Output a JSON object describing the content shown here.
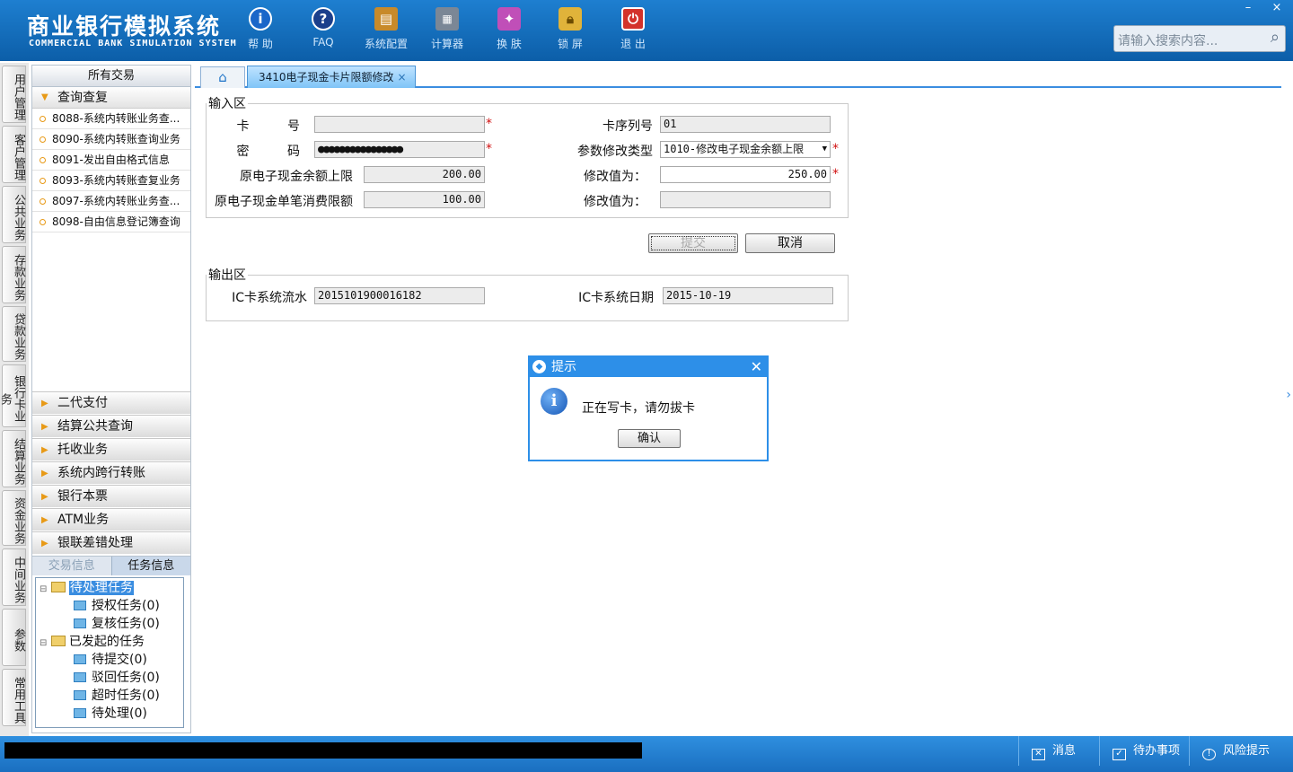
{
  "app": {
    "title_cn": "商业银行模拟系统",
    "title_en": "COMMERCIAL BANK SIMULATION SYSTEM"
  },
  "toolbar": [
    {
      "label": "帮 助",
      "icon": "help-icon",
      "color": "#1a66c9"
    },
    {
      "label": "FAQ",
      "icon": "faq-icon",
      "color": "#1b3f8c"
    },
    {
      "label": "系统配置",
      "icon": "config-toolbox-icon",
      "color": "#c88a2a"
    },
    {
      "label": "计算器",
      "icon": "calculator-icon",
      "color": "#7b8796"
    },
    {
      "label": "换 肤",
      "icon": "skin-shirt-icon",
      "color": "#c04fb8"
    },
    {
      "label": "锁 屏",
      "icon": "lock-icon",
      "color": "#e0b33a"
    },
    {
      "label": "退 出",
      "icon": "power-icon",
      "color": "#d3322b"
    }
  ],
  "window": {
    "minimize": "–",
    "close": "×"
  },
  "search": {
    "placeholder": "请输入搜索内容..."
  },
  "side_tabs": [
    "用户管理",
    "客户管理",
    "公共业务",
    "存款业务",
    "贷款业务",
    "银行卡业务",
    "结算业务",
    "资金业务",
    "中间业务",
    "参数",
    "常用工具"
  ],
  "left_panel": {
    "header": "所有交易",
    "open_group": "查询查复",
    "items": [
      "8088-系统内转账业务查...",
      "8090-系统内转账查询业务",
      "8091-发出自由格式信息",
      "8093-系统内转账查复业务",
      "8097-系统内转账业务查...",
      "8098-自由信息登记簿查询"
    ],
    "groups": [
      "二代支付",
      "结算公共查询",
      "托收业务",
      "系统内跨行转账",
      "银行本票",
      "ATM业务",
      "银联差错处理"
    ],
    "subtabs": [
      "交易信息",
      "任务信息"
    ],
    "tree": {
      "pending": "待处理任务",
      "pending_children": [
        "授权任务(0)",
        "复核任务(0)"
      ],
      "initiated": "已发起的任务",
      "initiated_children": [
        "待提交(0)",
        "驳回任务(0)",
        "超时任务(0)",
        "待处理(0)"
      ]
    }
  },
  "tabs": {
    "active": "3410电子现金卡片限额修改",
    "close": "×"
  },
  "input_area": {
    "legend": "输入区",
    "card_no_label": "卡 　号",
    "card_no_value": "",
    "password_label": "密 　码",
    "password_value": "●●●●●●●●●●●●●●●●",
    "orig_balance_limit_label": "原电子现金余额上限",
    "orig_balance_limit_value": "200.00",
    "orig_single_limit_label": "原电子现金单笔消费限额",
    "orig_single_limit_value": "100.00",
    "card_seq_label": "卡序列号",
    "card_seq_value": "01",
    "param_type_label": "参数修改类型",
    "param_type_value": "1010-修改电子现金余额上限",
    "modify1_label": "修改值为：",
    "modify1_value": "250.00",
    "modify2_label": "修改值为：",
    "modify2_value": "",
    "required_mark": "*"
  },
  "buttons": {
    "submit": "提交",
    "cancel": "取消"
  },
  "output_area": {
    "legend": "输出区",
    "serial_label": "IC卡系统流水",
    "serial_value": "2015101900016182",
    "date_label": "IC卡系统日期",
    "date_value": "2015-10-19"
  },
  "dialog": {
    "title": "提示",
    "message": "正在写卡，请勿拔卡",
    "ok": "确认",
    "close": "✕"
  },
  "status_bar": {
    "message": "消息",
    "todo": "待办事项",
    "risk": "风险提示"
  }
}
